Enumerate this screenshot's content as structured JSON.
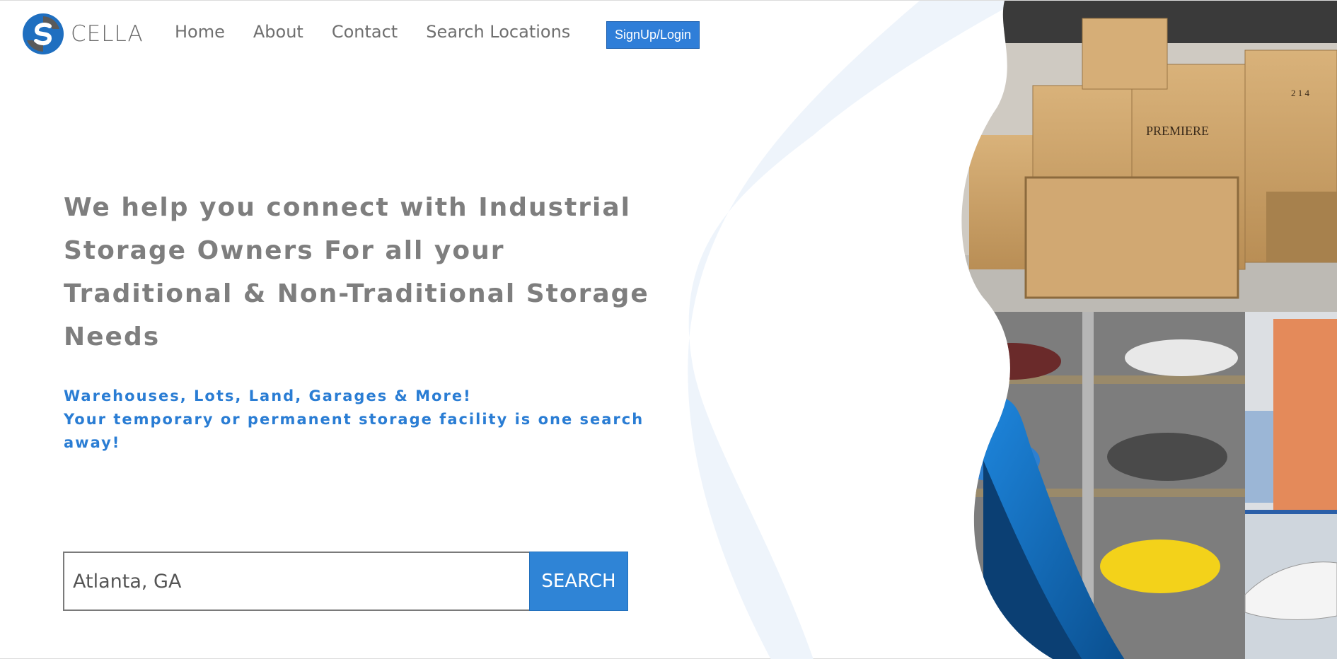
{
  "brand": {
    "name": "CELLA"
  },
  "nav": {
    "items": [
      "Home",
      "About",
      "Contact",
      "Search Locations"
    ],
    "signup_label": "SignUp/Login"
  },
  "hero": {
    "headline": "We help you connect with Industrial Storage Owners For all your Traditional & Non-Traditional Storage Needs",
    "tagline_line1": "Warehouses, Lots, Land, Garages & More!",
    "tagline_line2": "Your temporary or permanent storage facility is one search away!"
  },
  "search": {
    "value": "Atlanta, GA",
    "button_label": "SEARCH"
  },
  "collage": {
    "crate_labels": [
      "PREMIERE",
      "PREMIERE",
      "PREMIERE"
    ],
    "crate_numbers": "2 1 4"
  },
  "colors": {
    "accent": "#2f7ed8",
    "tagline": "#2a7dd4",
    "headline": "#7e7e7e",
    "swoosh_dark": "#0a4f8f",
    "swoosh_light": "#eef4fb"
  }
}
